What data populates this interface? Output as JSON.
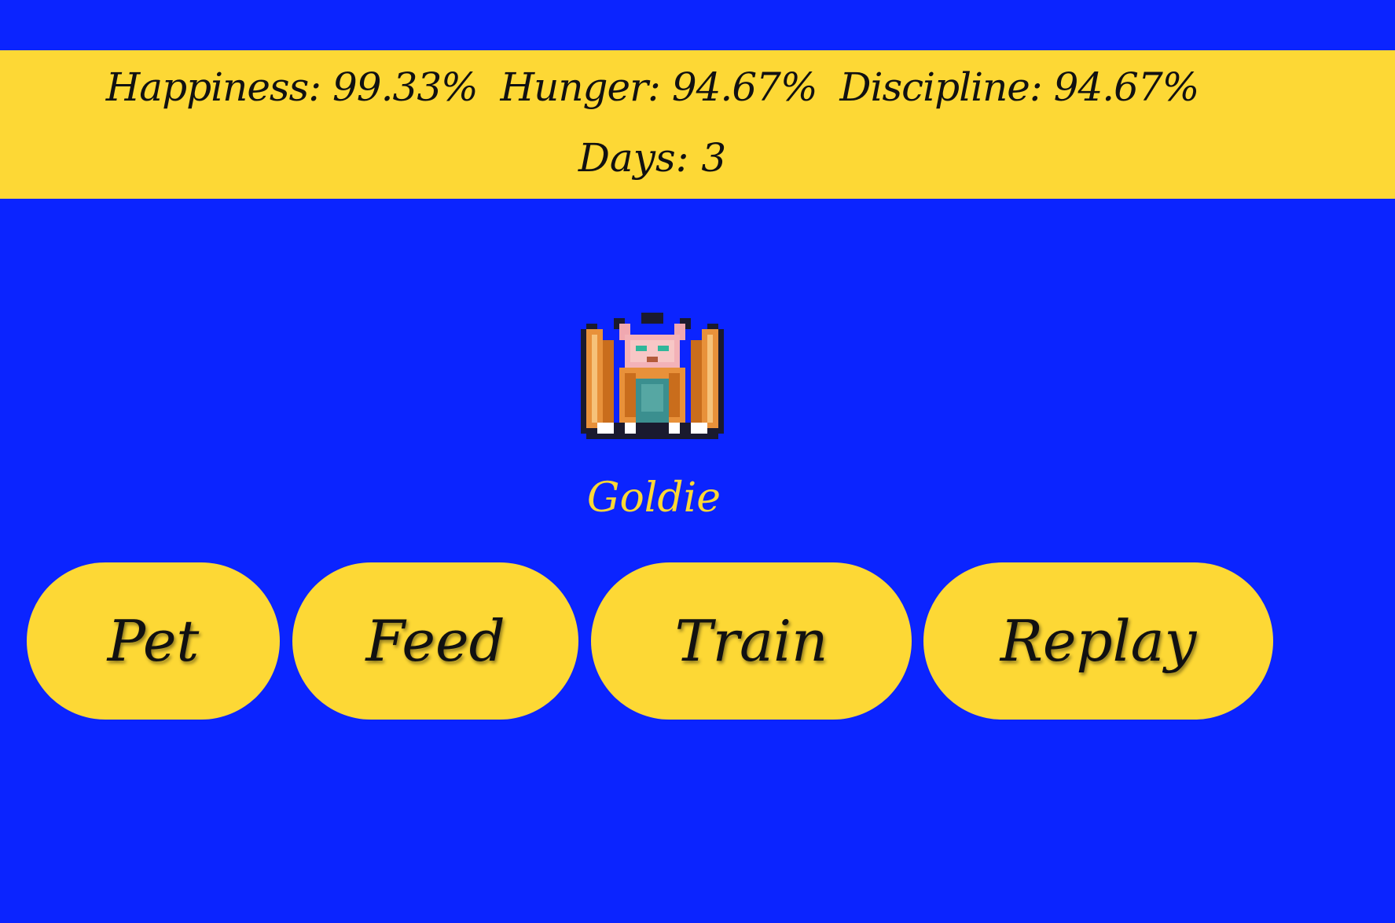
{
  "stats": {
    "happiness_label": "Happiness:",
    "happiness_value": "99.33%",
    "hunger_label": "Hunger:",
    "hunger_value": "94.67%",
    "discipline_label": "Discipline:",
    "discipline_value": "94.67%",
    "days_label": "Days:",
    "days_value": "3"
  },
  "pet": {
    "name": "Goldie",
    "sprite": "winged-cat-creature-icon"
  },
  "actions": {
    "pet_label": "Pet",
    "feed_label": "Feed",
    "train_label": "Train",
    "replay_label": "Replay"
  },
  "colors": {
    "background": "#0b24ff",
    "accent": "#fdd835",
    "text": "#111111"
  }
}
